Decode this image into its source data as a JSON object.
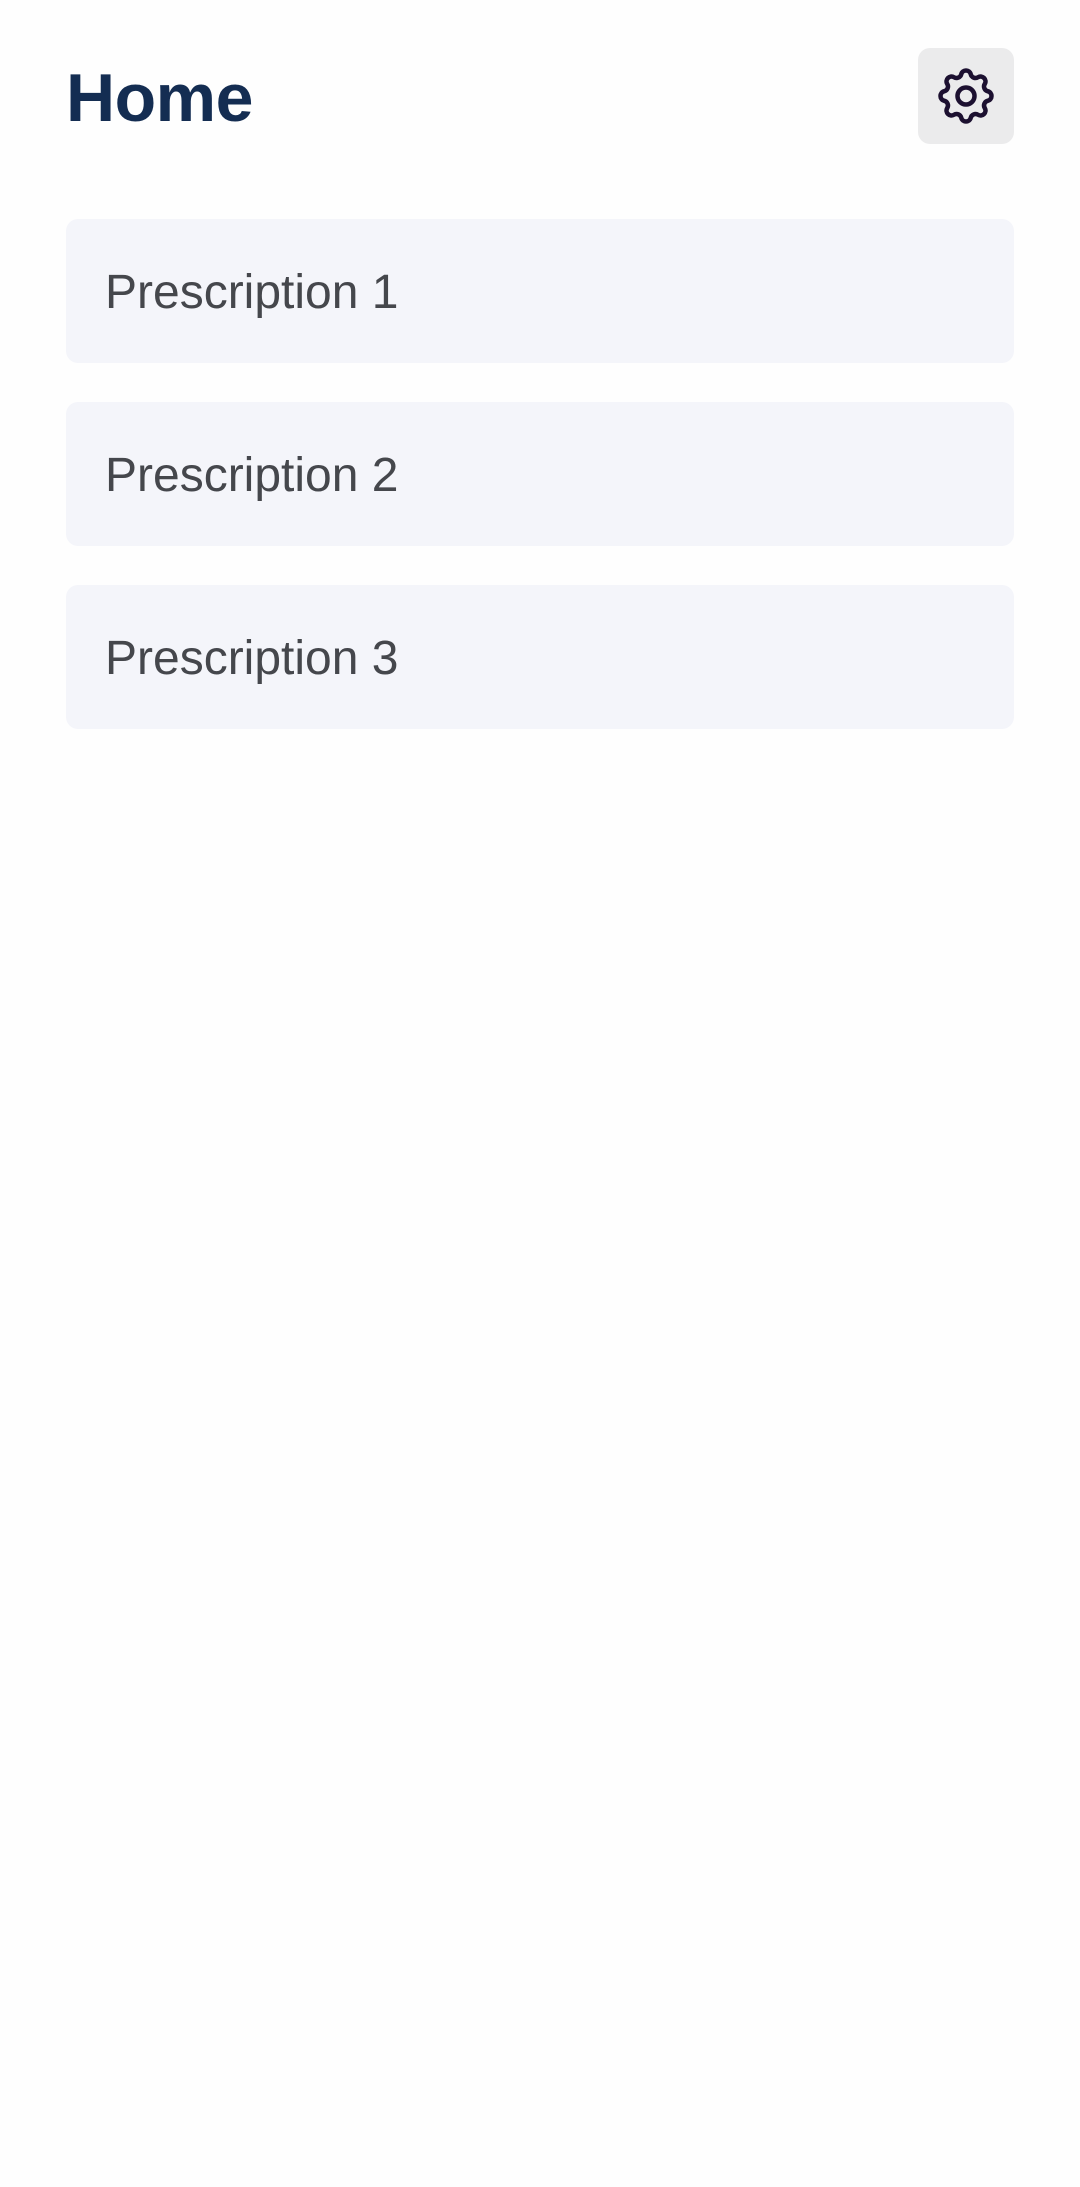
{
  "header": {
    "title": "Home",
    "settings_icon": "gear-icon"
  },
  "prescriptions": [
    {
      "label": "Prescription 1"
    },
    {
      "label": "Prescription 2"
    },
    {
      "label": "Prescription 3"
    }
  ],
  "colors": {
    "title": "#142d52",
    "card_background": "#f4f5fa",
    "card_text": "#45474c",
    "settings_button_background": "#ebebec",
    "icon_stroke": "#1c1030",
    "page_background": "#fefefe"
  }
}
